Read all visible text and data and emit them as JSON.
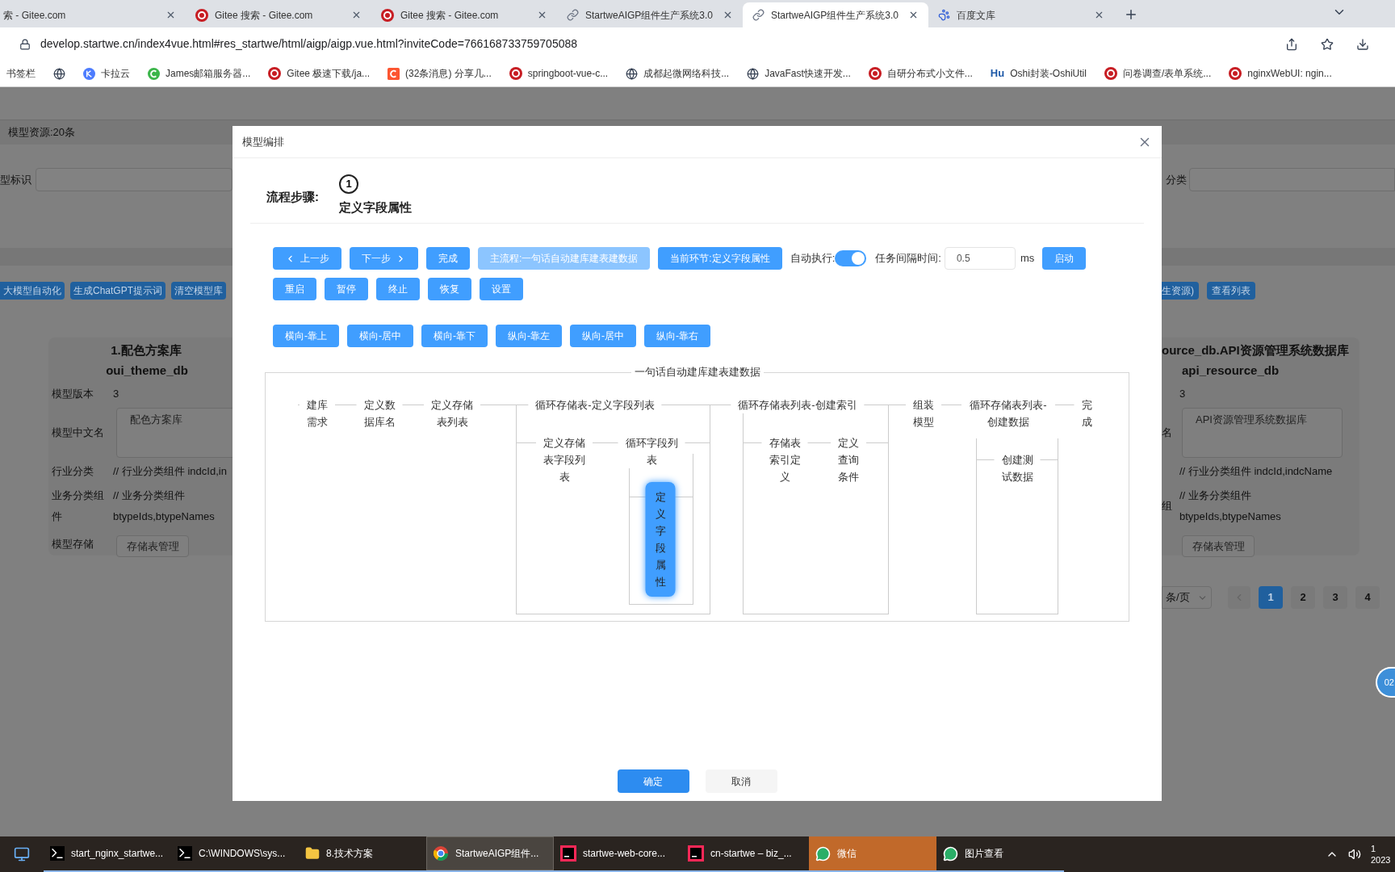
{
  "browser": {
    "tabs": [
      {
        "title": "索 - Gitee.com",
        "selected": false
      },
      {
        "title": "Gitee 搜索 - Gitee.com",
        "kind": "mark",
        "selected": false
      },
      {
        "title": "Gitee 搜索 - Gitee.com",
        "kind": "mark",
        "selected": false
      },
      {
        "title": "StartweAIGP组件生产系统3.0",
        "kind": "link",
        "selected": false
      },
      {
        "title": "StartweAIGP组件生产系统3.0",
        "kind": "link",
        "selected": true
      },
      {
        "title": "百度文库",
        "kind": "paw",
        "selected": false
      }
    ],
    "url": "develop.startwe.cn/index4vue.html#res_startwe/html/aigp/aigp.vue.html?inviteCode=766168733759705088",
    "bookmarks": [
      {
        "label": "书签栏",
        "kind": "folder"
      },
      {
        "kind": "globe"
      },
      {
        "label": "卡拉云",
        "kind": "round"
      },
      {
        "label": "James邮箱服务器...",
        "kind": "leaf"
      },
      {
        "label": "Gitee 极速下载/ja...",
        "kind": "mark"
      },
      {
        "label": "(32条消息) 分享几...",
        "kind": "square"
      },
      {
        "label": "springboot-vue-c...",
        "kind": "mark"
      },
      {
        "label": "成都起微网络科技...",
        "kind": "globe"
      },
      {
        "label": "JavaFast快速开发...",
        "kind": "globe"
      },
      {
        "label": "自研分布式小文件...",
        "kind": "mark"
      },
      {
        "label": "Oshi封装-OshiUtil",
        "kind": "text",
        "icon_text": "Hu"
      },
      {
        "label": "问卷调查/表单系统...",
        "kind": "mark"
      },
      {
        "label": "nginxWebUI: ngin...",
        "kind": "mark"
      }
    ]
  },
  "page": {
    "resource_count": "模型资源:20条",
    "filters": [
      {
        "label": "型标识"
      },
      {
        "label": "分类"
      }
    ],
    "toolbar_left": [
      "大模型自动化",
      "生成ChatGPT提示词",
      "清空模型库"
    ],
    "toolbar_right": [
      "生资源)",
      "查看列表"
    ],
    "cards": [
      {
        "title": "1.配色方案库",
        "name": "oui_theme_db",
        "fields": [
          {
            "label": "模型版本",
            "value": "3",
            "kind": "text"
          },
          {
            "label": "模型中文名",
            "value": "配色方案库",
            "kind": "textarea"
          },
          {
            "label": "行业分类",
            "value": "// 行业分类组件 indcId,in",
            "kind": "text"
          },
          {
            "label": "业务分类组件",
            "value": "// 业务分类组件 btypeIds,btypeNames",
            "kind": "text"
          },
          {
            "label": "模型存储",
            "value": "存储表管理",
            "kind": "button"
          }
        ]
      },
      {
        "title": "ource_db.API资源管理系统数据库",
        "name": "api_resource_db",
        "fields": [
          {
            "value": "3",
            "kind": "text"
          },
          {
            "label": "名",
            "value": "API资源管理系统数据库",
            "kind": "textarea"
          },
          {
            "value": "// 行业分类组件 indcId,indcName",
            "kind": "text"
          },
          {
            "label": "组",
            "value": "// 业务分类组件 btypeIds,btypeNames",
            "kind": "text"
          },
          {
            "value": "存储表管理",
            "kind": "button"
          }
        ]
      }
    ],
    "pagination": {
      "page_size": "条/页",
      "pages": [
        {
          "label": "1",
          "selected": true
        },
        {
          "label": "2",
          "selected": false
        },
        {
          "label": "3",
          "selected": false
        },
        {
          "label": "4",
          "selected": false
        }
      ]
    },
    "float_badge": "02"
  },
  "dialog": {
    "title": "模型编排",
    "step_label": "流程步骤:",
    "step_number": "1",
    "step_name": "定义字段属性",
    "row1": [
      {
        "kind": "prev",
        "label": "上一步",
        "disabled": false
      },
      {
        "kind": "next",
        "label": "下一步",
        "disabled": false
      },
      {
        "kind": "button",
        "label": "完成",
        "disabled": false
      },
      {
        "kind": "button",
        "label": "主流程:一句话自动建库建表建数据",
        "disabled": true
      },
      {
        "kind": "button",
        "label": "当前环节:定义字段属性",
        "disabled": false
      },
      {
        "kind": "toggle",
        "label": "自动执行:",
        "on": true
      },
      {
        "kind": "input",
        "label": "任务间隔时间:",
        "value": "0.5",
        "unit": "ms"
      },
      {
        "kind": "button",
        "label": "启动",
        "disabled": false
      }
    ],
    "row2": [
      "重启",
      "暂停",
      "终止",
      "恢复",
      "设置"
    ],
    "row3": [
      "横向-靠上",
      "横向-居中",
      "横向-靠下",
      "纵向-靠左",
      "纵向-居中",
      "纵向-靠右"
    ],
    "flow": {
      "title": "一句话自动建库建表建数据",
      "nodes": [
        {
          "label": "建库需求",
          "active": false
        },
        {
          "label": "定义数据库名",
          "active": false
        },
        {
          "label": "定义存储表列表",
          "active": false
        },
        {
          "label": "循环存储表-定义字段列表",
          "active": false,
          "children": [
            {
              "label": "定义存储表字段列表",
              "active": false
            },
            {
              "label": "循环字段列表",
              "active": false,
              "children": [
                {
                  "label": "定义字段属性",
                  "active": true
                }
              ]
            }
          ]
        },
        {
          "label": "循环存储表列表-创建索引",
          "active": false,
          "children": [
            {
              "label": "存储表索引定义",
              "active": false
            },
            {
              "label": "定义查询条件",
              "active": false
            }
          ]
        },
        {
          "label": "组装模型",
          "active": false
        },
        {
          "label": "循环存储表列表-创建数据",
          "active": false,
          "children": [
            {
              "label": "创建测试数据",
              "active": false
            }
          ]
        },
        {
          "label": "完成",
          "active": false
        }
      ]
    },
    "footer": [
      {
        "label": "确定",
        "kind": "primary"
      },
      {
        "label": "取消",
        "kind": "default"
      }
    ]
  },
  "taskbar": {
    "items": [
      {
        "label": "start_nginx_startwe...",
        "kind": "terminal",
        "selected": false,
        "flashing": false
      },
      {
        "label": "C:\\WINDOWS\\sys...",
        "kind": "terminal",
        "selected": false,
        "flashing": false
      },
      {
        "label": "8.技术方案",
        "kind": "folder",
        "selected": false,
        "flashing": false
      },
      {
        "label": "StartweAIGP组件...",
        "kind": "browser",
        "selected": true,
        "flashing": false
      },
      {
        "label": "startwe-web-core...",
        "kind": "ide",
        "selected": false,
        "flashing": false
      },
      {
        "label": "cn-startwe – biz_...",
        "kind": "ide",
        "selected": false,
        "flashing": false
      },
      {
        "label": "微信",
        "kind": "chat",
        "selected": false,
        "flashing": true
      },
      {
        "label": "图片查看",
        "kind": "chat",
        "selected": false,
        "flashing": false
      }
    ],
    "clock": [
      "1",
      "2023"
    ]
  }
}
